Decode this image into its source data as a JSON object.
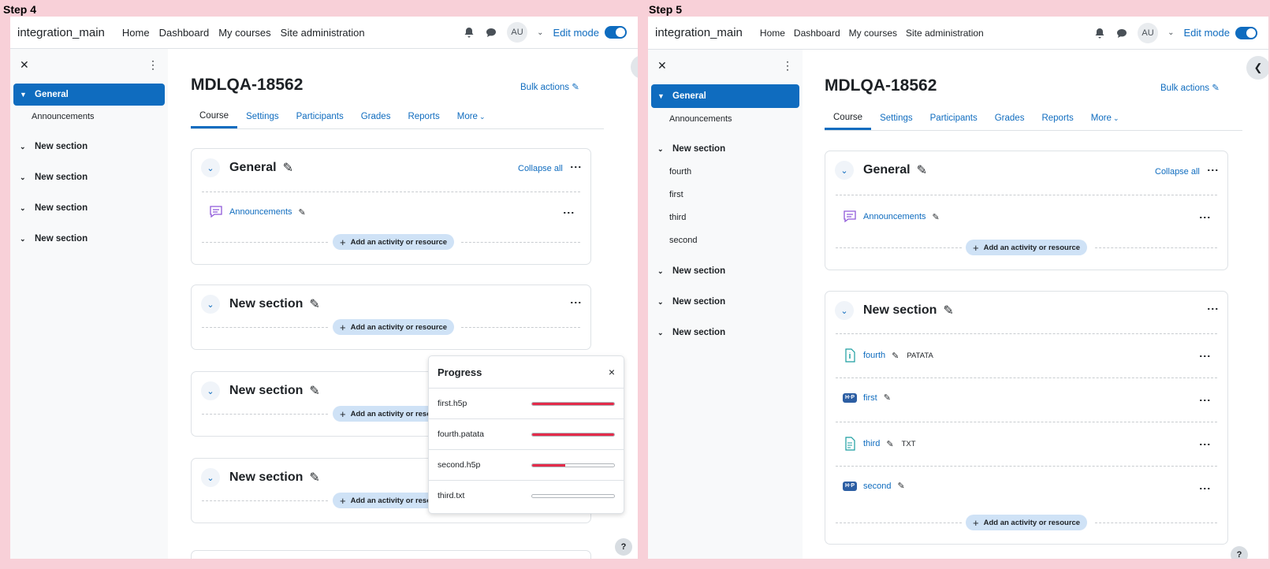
{
  "steps": {
    "left": "Step 4",
    "right": "Step 5"
  },
  "navbar": {
    "brand": "integration_main",
    "links": [
      "Home",
      "Dashboard",
      "My courses",
      "Site administration"
    ],
    "avatar": "AU",
    "edit_mode": "Edit mode"
  },
  "course": {
    "title": "MDLQA-18562",
    "bulk_actions": "Bulk actions",
    "tabs": [
      "Course",
      "Settings",
      "Participants",
      "Grades",
      "Reports",
      "More"
    ]
  },
  "left": {
    "drawer": {
      "general": "General",
      "announcements": "Announcements",
      "sections": [
        "New section",
        "New section",
        "New section",
        "New section"
      ]
    },
    "general": {
      "title": "General",
      "collapse_all": "Collapse all",
      "activity": "Announcements"
    },
    "section_title": "New section",
    "add_label": "Add an activity or resource",
    "progress": {
      "title": "Progress",
      "close": "×",
      "rows": [
        {
          "name": "first.h5p",
          "pct": 100
        },
        {
          "name": "fourth.patata",
          "pct": 100
        },
        {
          "name": "second.h5p",
          "pct": 40
        },
        {
          "name": "third.txt",
          "pct": 0
        }
      ]
    }
  },
  "right": {
    "drawer": {
      "general": "General",
      "announcements": "Announcements",
      "section1": "New section",
      "children": [
        "fourth",
        "first",
        "third",
        "second"
      ],
      "sections": [
        "New section",
        "New section",
        "New section"
      ]
    },
    "general": {
      "title": "General",
      "collapse_all": "Collapse all",
      "activity": "Announcements"
    },
    "section": {
      "title": "New section",
      "activities": [
        {
          "name": "fourth",
          "badge": "PATATA",
          "icon": "file-info-icon"
        },
        {
          "name": "first",
          "badge": "",
          "icon": "h5p-icon"
        },
        {
          "name": "third",
          "badge": "TXT",
          "icon": "text-file-icon"
        },
        {
          "name": "second",
          "badge": "",
          "icon": "h5p-icon"
        }
      ]
    },
    "add_label": "Add an activity or resource"
  },
  "help": "?",
  "colors": {
    "accent": "#0f6cbf",
    "progress_red": "#e32b4a",
    "background": "#f8d0d8"
  }
}
